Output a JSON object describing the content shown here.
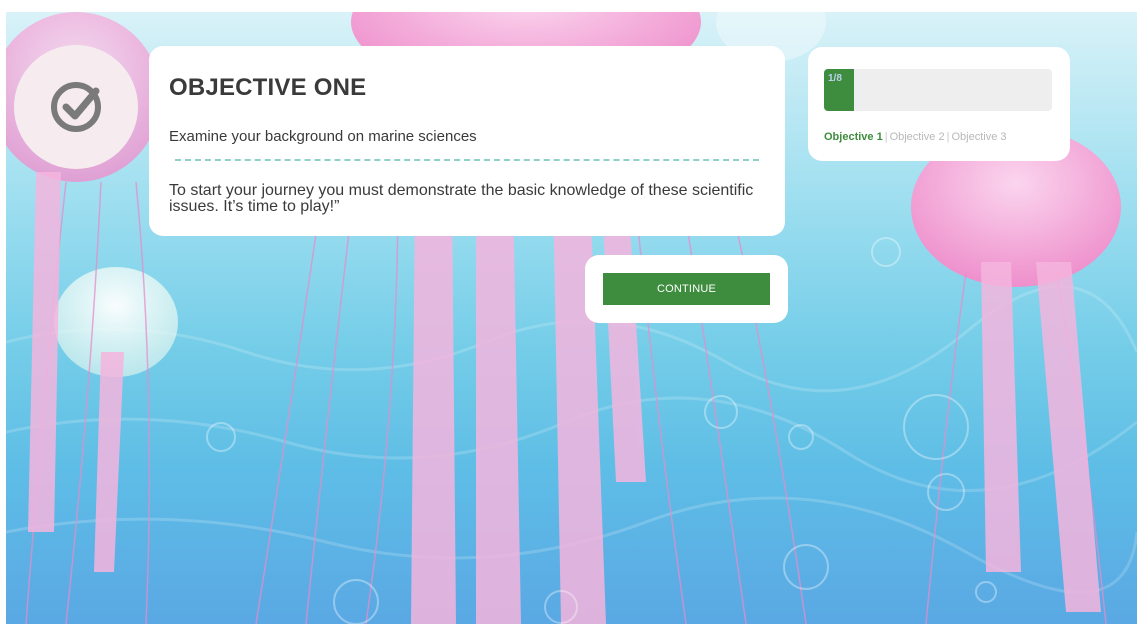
{
  "objective": {
    "title": "OBJECTIVE ONE",
    "subtitle": "Examine your background on marine sciences",
    "body": "To start your journey you must demonstrate the basic knowledge of these scientific issues. It’s time to play!”",
    "badge_icon": "check-circle-icon"
  },
  "continue_button": {
    "label": "CONTINUE"
  },
  "progress": {
    "label": "1/8",
    "fraction": 0.125,
    "objectives": [
      {
        "label": "Objective 1",
        "active": true
      },
      {
        "label": "Objective 2",
        "active": false
      },
      {
        "label": "Objective 3",
        "active": false
      }
    ]
  },
  "colors": {
    "accent": "#3e8d3e",
    "text": "#3a3a3a",
    "divider": "#8fd0c7",
    "jellyfish": "#f4a8d8",
    "water_top": "#d9f2f8",
    "water_bottom": "#5aa8e4"
  }
}
